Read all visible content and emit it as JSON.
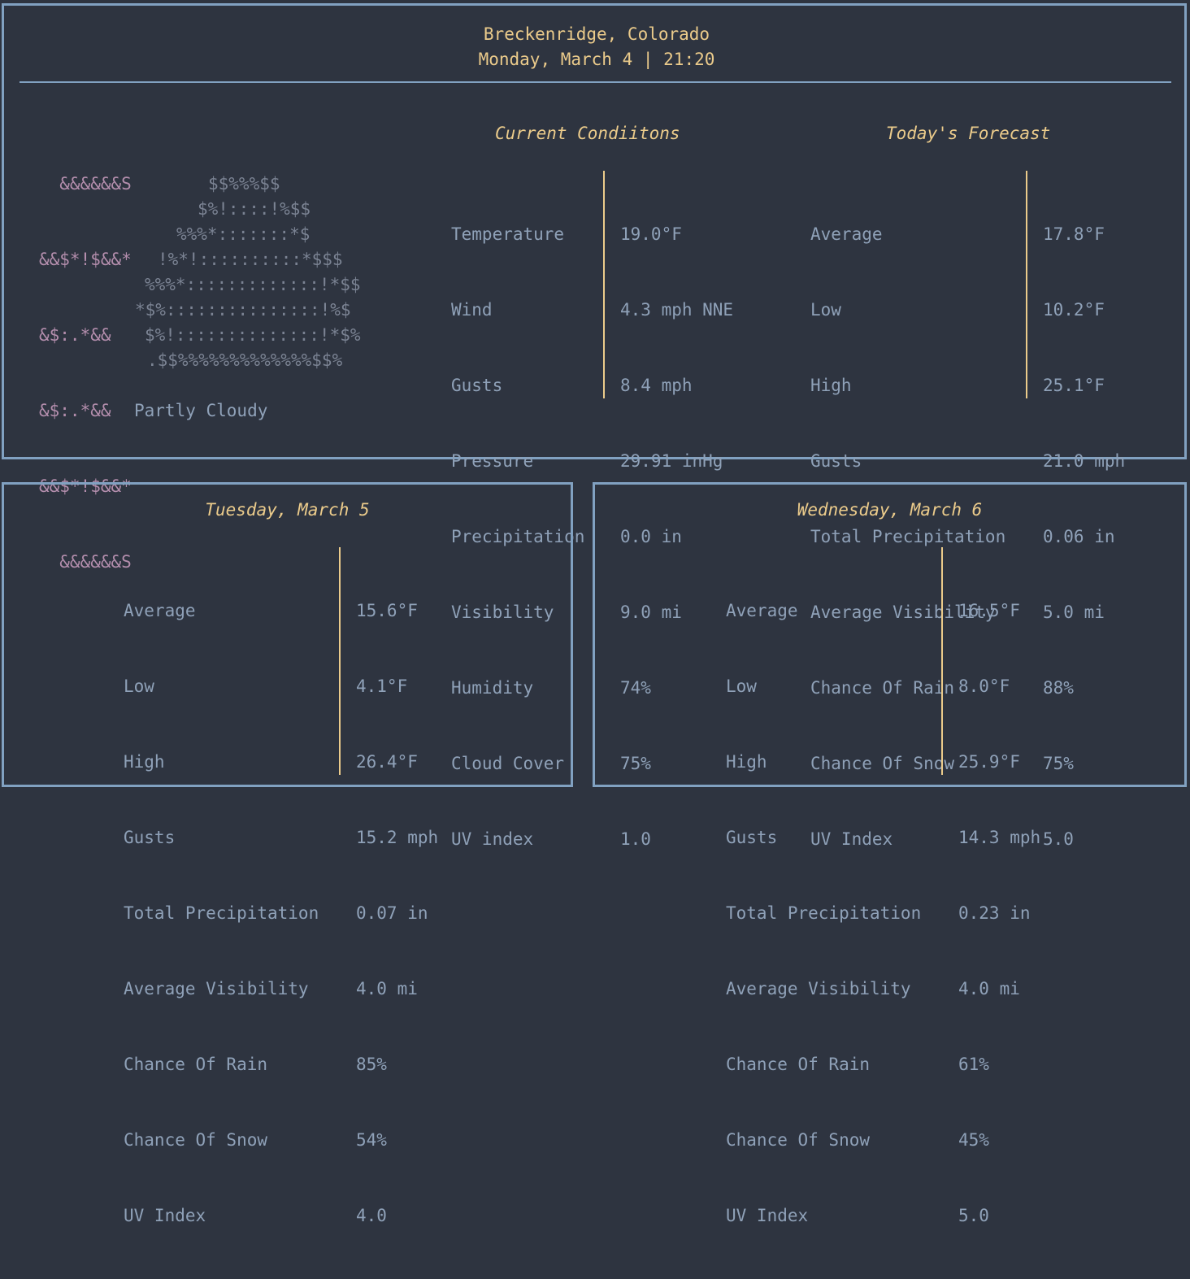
{
  "header": {
    "location": "Breckenridge, Colorado",
    "datetime": "Monday, March 4 | 21:20"
  },
  "current": {
    "ascii_moon": [
      "  &&&&&&S",
      "&&$*!$&&*",
      "&$:.*&&",
      "&$:.*&&",
      "&&$*!$&&*",
      "  &&&&&&S"
    ],
    "ascii_cloud": [
      "$$%%%$$",
      "$%!::::!%$$",
      "%%%*:::::::*$",
      "!%*!::::::::::*$$$",
      "%%%*:::::::::::::!*$$",
      "*$%:::::::::::::::!%$",
      "$%!::::::::::::::!*$%",
      ".$$%%%%%%%%%%%%%$$%"
    ],
    "condition": "Partly Cloudy",
    "title": "Current Condiitons",
    "labels": [
      "Temperature",
      "Wind",
      "Gusts",
      "Pressure",
      "Precipitation",
      "Visibility",
      "Humidity",
      "Cloud Cover",
      "UV index"
    ],
    "values": [
      "19.0°F",
      "4.3 mph NNE",
      "8.4 mph",
      "29.91 inHg",
      "0.0 in",
      "9.0 mi",
      "74%",
      "75%",
      "1.0"
    ]
  },
  "today": {
    "title": "Today's Forecast",
    "labels": [
      "Average",
      "Low",
      "High",
      "Gusts",
      "Total Precipitation",
      "Average Visibility",
      "Chance Of Rain",
      "Chance Of Snow",
      "UV Index"
    ],
    "values": [
      "17.8°F",
      "10.2°F",
      "25.1°F",
      "21.0 mph",
      "0.06 in",
      "5.0 mi",
      "88%",
      "75%",
      "5.0"
    ]
  },
  "tuesday": {
    "title": "Tuesday, March 5",
    "labels": [
      "Average",
      "Low",
      "High",
      "Gusts",
      "Total Precipitation",
      "Average Visibility",
      "Chance Of Rain",
      "Chance Of Snow",
      "UV Index"
    ],
    "values": [
      "15.6°F",
      "4.1°F",
      "26.4°F",
      "15.2 mph",
      "0.07 in",
      "4.0 mi",
      "85%",
      "54%",
      "4.0"
    ]
  },
  "wednesday": {
    "title": "Wednesday, March 6",
    "labels": [
      "Average",
      "Low",
      "High",
      "Gusts",
      "Total Precipitation",
      "Average Visibility",
      "Chance Of Rain",
      "Chance Of Snow",
      "UV Index"
    ],
    "values": [
      "16.5°F",
      "8.0°F",
      "25.9°F",
      "14.3 mph",
      "0.23 in",
      "4.0 mi",
      "61%",
      "45%",
      "5.0"
    ]
  },
  "colors": {
    "background": "#2e3440",
    "border": "#81a1c1",
    "accent": "#ebcb8b",
    "text": "#8fa1b8",
    "moon": "#b48ead",
    "cloud": "#7b8393"
  }
}
